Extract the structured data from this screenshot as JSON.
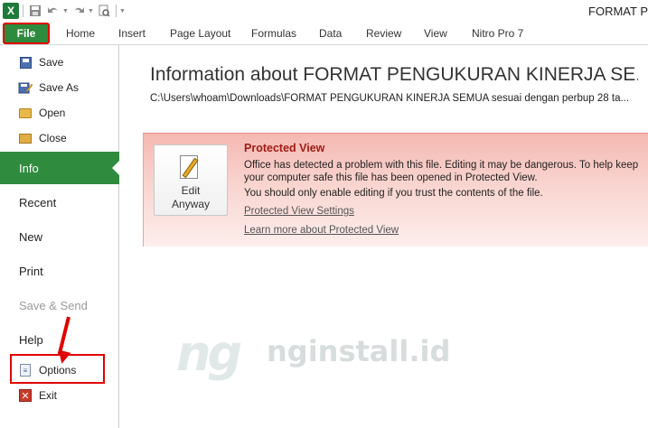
{
  "window": {
    "title": "FORMAT P"
  },
  "qat": {
    "app_icon_text": "X",
    "save": "save-icon",
    "undo": "undo-icon",
    "redo": "redo-icon",
    "preview": "print-preview-icon"
  },
  "ribbon": {
    "file_tab": "File",
    "tabs": [
      "Home",
      "Insert",
      "Page Layout",
      "Formulas",
      "Data",
      "Review",
      "View",
      "Nitro Pro 7"
    ]
  },
  "backstage": {
    "commands_top": [
      {
        "label": "Save",
        "icon": "save-icon"
      },
      {
        "label": "Save As",
        "icon": "save-as-icon"
      },
      {
        "label": "Open",
        "icon": "open-folder-icon"
      },
      {
        "label": "Close",
        "icon": "close-folder-icon"
      }
    ],
    "nav": [
      {
        "label": "Info",
        "active": true
      },
      {
        "label": "Recent"
      },
      {
        "label": "New"
      },
      {
        "label": "Print"
      },
      {
        "label": "Save & Send",
        "disabled": true
      },
      {
        "label": "Help"
      }
    ],
    "commands_bottom": [
      {
        "label": "Options",
        "icon": "options-icon"
      },
      {
        "label": "Exit",
        "icon": "exit-icon"
      }
    ]
  },
  "info": {
    "title": "Information about FORMAT PENGUKURAN KINERJA SE...",
    "path": "C:\\Users\\whoam\\Downloads\\FORMAT PENGUKURAN KINERJA SEMUA sesuai dengan perbup 28 ta..."
  },
  "protected_view": {
    "button_line1": "Edit",
    "button_line2": "Anyway",
    "title": "Protected View",
    "message": "Office has detected a problem with this file. Editing it may be dangerous. To help keep your computer safe this file has been opened in Protected View.",
    "message2": "You should only enable editing if you trust the contents of the file.",
    "link_settings": "Protected View Settings",
    "link_learn": "Learn more about Protected View"
  },
  "watermark": {
    "logo": "ng",
    "text": "nginstall.id"
  },
  "colors": {
    "accent": "#2f8b3e",
    "highlight": "#e00000",
    "pv_title": "#a01c14"
  }
}
